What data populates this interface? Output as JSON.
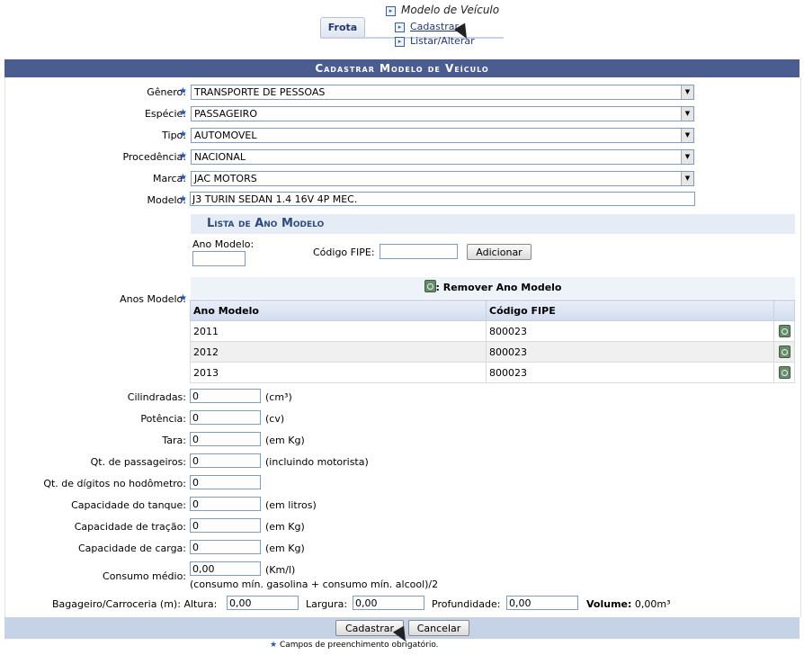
{
  "menu": {
    "tab": "Frota",
    "section": "Modelo de Veículo",
    "items": [
      "Cadastrar",
      "Listar/Alterar"
    ]
  },
  "form": {
    "caption": "Cadastrar Modelo de Veículo",
    "fields": {
      "genero": {
        "label": "Gênero:",
        "value": "TRANSPORTE DE PESSOAS"
      },
      "especie": {
        "label": "Espécie:",
        "value": "PASSAGEIRO"
      },
      "tipo": {
        "label": "Tipo:",
        "value": "AUTOMOVEL"
      },
      "procedencia": {
        "label": "Procedência:",
        "value": "NACIONAL"
      },
      "marca": {
        "label": "Marca:",
        "value": "JAC MOTORS"
      },
      "modelo": {
        "label": "Modelo:",
        "value": "J3 TURIN SEDAN 1.4 16V 4P MEC."
      }
    },
    "anos": {
      "label": "Anos Modelo:",
      "list_title": "Lista de Ano Modelo",
      "ano_label": "Ano Modelo:",
      "fipe_label": "Código FIPE:",
      "add_button": "Adicionar",
      "remove_legend": ": Remover Ano Modelo",
      "columns": [
        "Ano Modelo",
        "Código FIPE"
      ],
      "rows": [
        {
          "ano": "2011",
          "fipe": "800023"
        },
        {
          "ano": "2012",
          "fipe": "800023"
        },
        {
          "ano": "2013",
          "fipe": "800023"
        }
      ]
    },
    "specs": {
      "cilindradas": {
        "label": "Cilindradas:",
        "value": "0",
        "unit": "(cm³)"
      },
      "potencia": {
        "label": "Potência:",
        "value": "0",
        "unit": "(cv)"
      },
      "tara": {
        "label": "Tara:",
        "value": "0",
        "unit": "(em Kg)"
      },
      "passageiros": {
        "label": "Qt. de passageiros:",
        "value": "0",
        "unit": "(incluindo motorista)"
      },
      "digitos": {
        "label": "Qt. de dígitos no hodômetro:",
        "value": "0",
        "unit": ""
      },
      "tanque": {
        "label": "Capacidade do tanque:",
        "value": "0",
        "unit": "(em litros)"
      },
      "tracao": {
        "label": "Capacidade de tração:",
        "value": "0",
        "unit": "(em Kg)"
      },
      "carga": {
        "label": "Capacidade de carga:",
        "value": "0",
        "unit": "(em Kg)"
      },
      "consumo": {
        "label": "Consumo médio:",
        "value": "0,00",
        "unit": "(Km/l)",
        "note": "(consumo mín. gasolina + consumo mín. alcool)/2"
      }
    },
    "bagageiro": {
      "label": "Bagageiro/Carroceria (m):",
      "altura_label": "Altura:",
      "altura": "0,00",
      "largura_label": "Largura:",
      "largura": "0,00",
      "prof_label": "Profundidade:",
      "prof": "0,00",
      "volume_label": "Volume:",
      "volume": "0,00m³"
    },
    "buttons": {
      "submit": "Cadastrar",
      "cancel": "Cancelar"
    },
    "required_note": "Campos de preenchimento obrigatório."
  }
}
